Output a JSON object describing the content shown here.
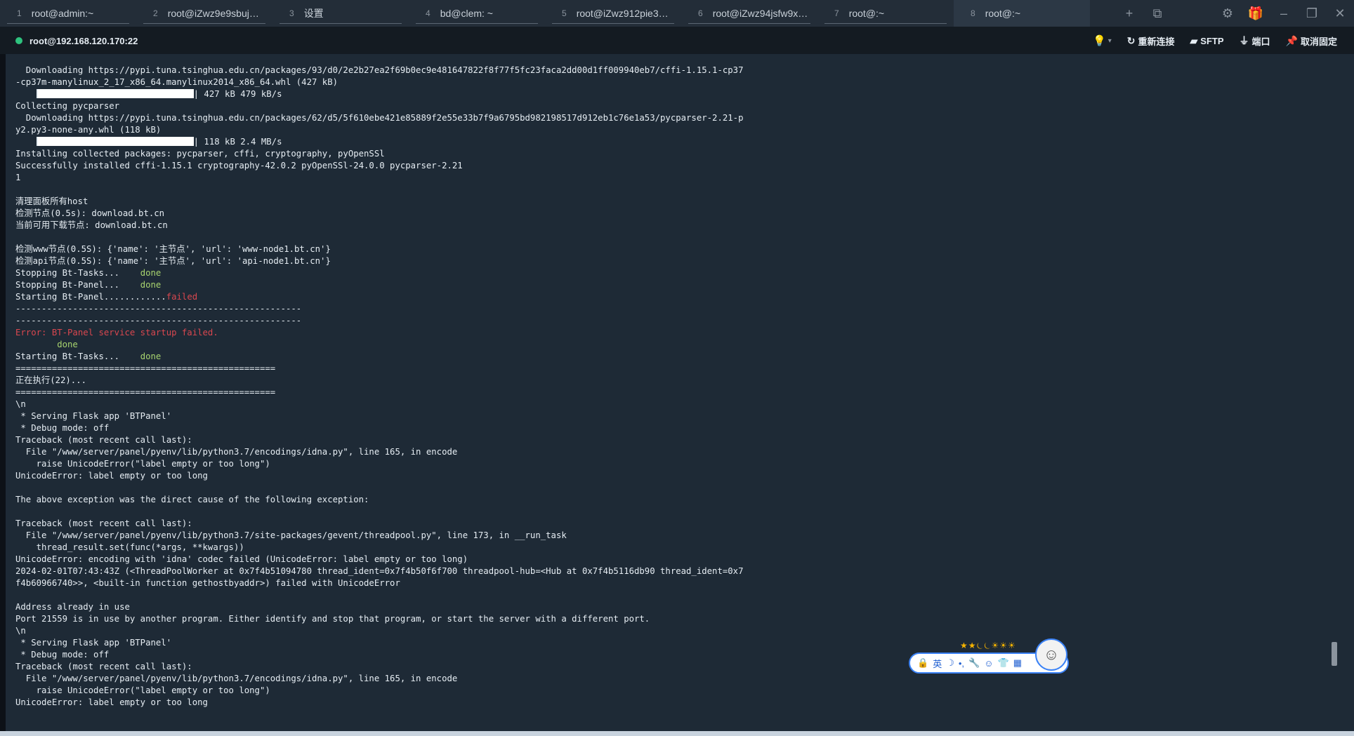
{
  "tabs": [
    {
      "num": "1",
      "title": "root@admin:~"
    },
    {
      "num": "2",
      "title": "root@iZwz9e9sbujml..."
    },
    {
      "num": "3",
      "title": "设置"
    },
    {
      "num": "4",
      "title": "bd@clem: ~"
    },
    {
      "num": "5",
      "title": "root@iZwz912pie3v8..."
    },
    {
      "num": "6",
      "title": "root@iZwz94jsfw9xu..."
    },
    {
      "num": "7",
      "title": "root@:~"
    },
    {
      "num": "8",
      "title": "root@:~"
    }
  ],
  "tabbar_icons": {
    "new_tab": "+",
    "layout": "⧉",
    "settings": "⚙",
    "gift": "🎁",
    "minimize": "–",
    "restore": "❐",
    "close": "✕"
  },
  "session": {
    "host": "root@192.168.120.170:22",
    "reconnect": "重新连接",
    "sftp": "SFTP",
    "port": "端口",
    "unpin": "取消固定"
  },
  "terminal_lines": [
    {
      "text": "  Downloading https://pypi.tuna.tsinghua.edu.cn/packages/93/d0/2e2b27ea2f69b0ec9e481647822f8f77f5fc23faca2dd00d1ff009940eb7/cffi-1.15.1-cp37",
      "cls": ""
    },
    {
      "text": "-cp37m-manylinux_2_17_x86_64.manylinux2014_x86_64.whl (427 kB)",
      "cls": ""
    },
    {
      "text": "| 427 kB 479 kB/s",
      "cls": "",
      "bar": true
    },
    {
      "text": "Collecting pycparser",
      "cls": ""
    },
    {
      "text": "  Downloading https://pypi.tuna.tsinghua.edu.cn/packages/62/d5/5f610ebe421e85889f2e55e33b7f9a6795bd982198517d912eb1c76e1a53/pycparser-2.21-p",
      "cls": ""
    },
    {
      "text": "y2.py3-none-any.whl (118 kB)",
      "cls": ""
    },
    {
      "text": "| 118 kB 2.4 MB/s",
      "cls": "",
      "bar": true
    },
    {
      "text": "Installing collected packages: pycparser, cffi, cryptography, pyOpenSSl",
      "cls": ""
    },
    {
      "text": "Successfully installed cffi-1.15.1 cryptography-42.0.2 pyOpenSSl-24.0.0 pycparser-2.21",
      "cls": ""
    },
    {
      "text": "1",
      "cls": ""
    },
    {
      "text": "",
      "cls": ""
    },
    {
      "text": "清理面板所有host",
      "cls": ""
    },
    {
      "text": "检测节点(0.5s): download.bt.cn",
      "cls": ""
    },
    {
      "text": "当前可用下载节点: download.bt.cn",
      "cls": ""
    },
    {
      "text": "",
      "cls": ""
    },
    {
      "text": "检测www节点(0.5S): {'name': '主节点', 'url': 'www-node1.bt.cn'}",
      "cls": ""
    },
    {
      "text": "检测api节点(0.5S): {'name': '主节点', 'url': 'api-node1.bt.cn'}",
      "cls": ""
    },
    {
      "text": "Stopping Bt-Tasks...    ",
      "cls": "",
      "suffix": "done",
      "suffix_cls": "c-green"
    },
    {
      "text": "Stopping Bt-Panel...    ",
      "cls": "",
      "suffix": "done",
      "suffix_cls": "c-green"
    },
    {
      "text": "Starting Bt-Panel............",
      "cls": "",
      "suffix": "failed",
      "suffix_cls": "c-red"
    },
    {
      "text": "-------------------------------------------------------",
      "cls": ""
    },
    {
      "text": "-------------------------------------------------------",
      "cls": ""
    },
    {
      "text": "Error: BT-Panel service startup failed.",
      "cls": "c-red"
    },
    {
      "text": "        done",
      "cls": "c-green"
    },
    {
      "text": "Starting Bt-Tasks...    ",
      "cls": "",
      "suffix": "done",
      "suffix_cls": "c-green"
    },
    {
      "text": "==================================================",
      "cls": ""
    },
    {
      "text": "正在执行(22)...",
      "cls": ""
    },
    {
      "text": "==================================================",
      "cls": ""
    },
    {
      "text": "\\n",
      "cls": ""
    },
    {
      "text": " * Serving Flask app 'BTPanel'",
      "cls": ""
    },
    {
      "text": " * Debug mode: off",
      "cls": ""
    },
    {
      "text": "Traceback (most recent call last):",
      "cls": ""
    },
    {
      "text": "  File \"/www/server/panel/pyenv/lib/python3.7/encodings/idna.py\", line 165, in encode",
      "cls": ""
    },
    {
      "text": "    raise UnicodeError(\"label empty or too long\")",
      "cls": ""
    },
    {
      "text": "UnicodeError: label empty or too long",
      "cls": ""
    },
    {
      "text": "",
      "cls": ""
    },
    {
      "text": "The above exception was the direct cause of the following exception:",
      "cls": ""
    },
    {
      "text": "",
      "cls": ""
    },
    {
      "text": "Traceback (most recent call last):",
      "cls": ""
    },
    {
      "text": "  File \"/www/server/panel/pyenv/lib/python3.7/site-packages/gevent/threadpool.py\", line 173, in __run_task",
      "cls": ""
    },
    {
      "text": "    thread_result.set(func(*args, **kwargs))",
      "cls": ""
    },
    {
      "text": "UnicodeError: encoding with 'idna' codec failed (UnicodeError: label empty or too long)",
      "cls": ""
    },
    {
      "text": "2024-02-01T07:43:43Z (<ThreadPoolWorker at 0x7f4b51094780 thread_ident=0x7f4b50f6f700 threadpool-hub=<Hub at 0x7f4b5116db90 thread_ident=0x7",
      "cls": ""
    },
    {
      "text": "f4b60966740>>, <built-in function gethostbyaddr>) failed with UnicodeError",
      "cls": ""
    },
    {
      "text": "",
      "cls": ""
    },
    {
      "text": "Address already in use",
      "cls": ""
    },
    {
      "text": "Port 21559 is in use by another program. Either identify and stop that program, or start the server with a different port.",
      "cls": ""
    },
    {
      "text": "\\n",
      "cls": ""
    },
    {
      "text": " * Serving Flask app 'BTPanel'",
      "cls": ""
    },
    {
      "text": " * Debug mode: off",
      "cls": ""
    },
    {
      "text": "Traceback (most recent call last):",
      "cls": ""
    },
    {
      "text": "  File \"/www/server/panel/pyenv/lib/python3.7/encodings/idna.py\", line 165, in encode",
      "cls": ""
    },
    {
      "text": "    raise UnicodeError(\"label empty or too long\")",
      "cls": ""
    },
    {
      "text": "UnicodeError: label empty or too long",
      "cls": ""
    }
  ],
  "ime": {
    "stars": "★★⏾⏾☀☀☀",
    "items": [
      "🔒",
      "英",
      "☽",
      "•,",
      "🔧",
      "☺",
      "👕",
      "▦"
    ],
    "avatar": "☺"
  },
  "colors": {
    "terminal_bg": "#1e2a36",
    "done": "#a8d46f",
    "failed": "#d9474f",
    "status_ok": "#2ec27e",
    "accent": "#4aa3ff"
  }
}
